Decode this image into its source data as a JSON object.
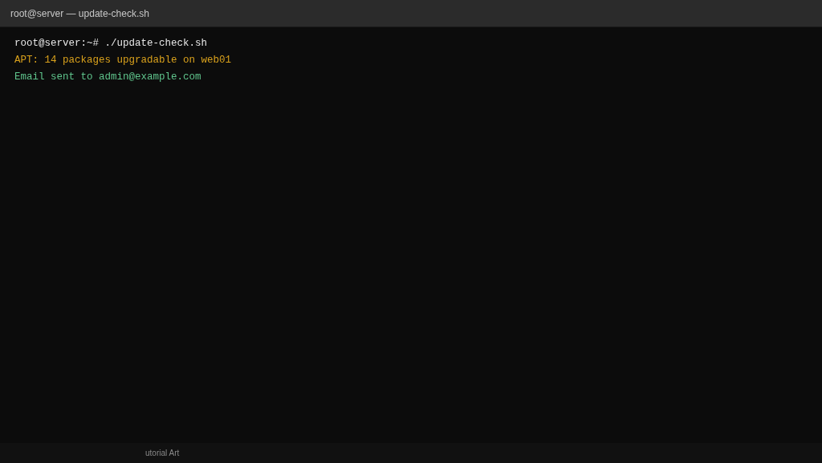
{
  "window": {
    "title": "root@server — update-check.sh"
  },
  "terminal": {
    "lines": [
      {
        "kind": "command",
        "text": "root@server:~# ./update-check.sh"
      },
      {
        "kind": "warning",
        "text": "APT: 14 packages upgradable on web01"
      },
      {
        "kind": "success",
        "text": "Email sent to admin@example.com"
      }
    ]
  },
  "footer": {
    "text": "utorial Art"
  }
}
